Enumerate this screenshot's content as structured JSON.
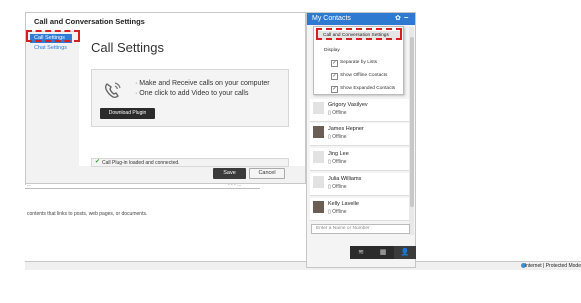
{
  "background_page": {
    "text": "contents that links to posts, web pages, or documents.",
    "dots_left": "...",
    "dots_right": "- - - ...",
    "status_text": "Internet | Protected Mode"
  },
  "settings": {
    "title": "Call and Conversation Settings",
    "nav": [
      "Call Settings",
      "Chat Settings"
    ],
    "heading": "Call Settings",
    "promo": [
      "· Make and Receive calls on your computer",
      "· One click to add Video to your calls"
    ],
    "download_label": "Download Plugin",
    "status_message": "Call Plug-in loaded and connected.",
    "save_label": "Save",
    "cancel_label": "Cancel"
  },
  "contacts": {
    "title": "My Contacts",
    "list": [
      {
        "name": "Grigory Vasilyev",
        "status": "Offline",
        "photo": false
      },
      {
        "name": "James Hepner",
        "status": "Offline",
        "photo": true
      },
      {
        "name": "Jing Lee",
        "status": "Offline",
        "photo": false
      },
      {
        "name": "Julia Williams",
        "status": "Offline",
        "photo": false
      },
      {
        "name": "Kelly Lavelle",
        "status": "Offline",
        "photo": true
      }
    ],
    "search_placeholder": "Enter a Name or Number"
  },
  "dropdown": {
    "item": "Call and Conversation Settings",
    "section": "Display",
    "options": [
      {
        "label": "Separate by Lists",
        "checked": true
      },
      {
        "label": "Show Offline Contacts",
        "checked": true
      },
      {
        "label": "Show Expanded Contacts",
        "checked": true
      }
    ]
  },
  "colors": {
    "accent": "#2d7ad0",
    "highlight": "#d62020",
    "online_check": "#3aa03a"
  }
}
